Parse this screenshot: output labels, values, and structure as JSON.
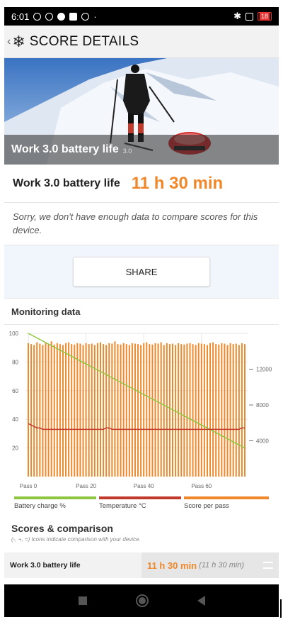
{
  "status_bar": {
    "time": "6:01",
    "battery": "18",
    "icons": [
      "alarm-off-icon",
      "alarm-icon",
      "apple-icon",
      "square-icon",
      "pie-icon",
      "dot-icon",
      "bluetooth-icon",
      "sim-icon",
      "battery-icon"
    ]
  },
  "header": {
    "back_icon": "chevron-left-icon",
    "logo_icon": "snowflake-icon",
    "title": "SCORE DETAILS"
  },
  "hero": {
    "title": "Work 3.0 battery life",
    "version": "3.0"
  },
  "score": {
    "label": "Work 3.0 battery life",
    "value": "11 h 30 min"
  },
  "message": "Sorry, we don't have enough data to compare scores for this device.",
  "share_label": "SHARE",
  "monitoring": {
    "title": "Monitoring data"
  },
  "chart_data": {
    "type": "line",
    "x_label_prefix": "Pass",
    "x_ticks": [
      "Pass 0",
      "Pass 20",
      "Pass 40",
      "Pass 60"
    ],
    "y_left_ticks": [
      "100",
      "80",
      "60",
      "40",
      "20"
    ],
    "y_right_ticks": [
      "12000",
      "8000",
      "4000"
    ],
    "pass_count": 76,
    "battery_charge_start": 100,
    "battery_charge_end": 20,
    "temperature_values": [
      37,
      36,
      35,
      34,
      34,
      33,
      33,
      33,
      33,
      33,
      33,
      33,
      33,
      33,
      33,
      33,
      33,
      33,
      33,
      33,
      33,
      33,
      33,
      33,
      33,
      33,
      33,
      34,
      34,
      33,
      33,
      33,
      33,
      33,
      33,
      33,
      33,
      33,
      33,
      33,
      33,
      33,
      33,
      33,
      33,
      33,
      33,
      33,
      33,
      33,
      33,
      33,
      33,
      33,
      33,
      33,
      33,
      33,
      33,
      33,
      33,
      33,
      33,
      33,
      33,
      33,
      33,
      33,
      33,
      33,
      33,
      33,
      33,
      33,
      34,
      34
    ],
    "score_values": [
      14900,
      14800,
      14700,
      15000,
      14850,
      14700,
      14900,
      14800,
      15100,
      14750,
      14900,
      14800,
      14700,
      14900,
      15000,
      14800,
      14750,
      14900,
      14850,
      14700,
      14900,
      14800,
      14850,
      14700,
      14900,
      15000,
      14800,
      14700,
      14900,
      14850,
      15100,
      14800,
      14750,
      14900,
      14800,
      14700,
      14900,
      14850,
      14800,
      14700,
      14900,
      15000,
      14800,
      14750,
      14900,
      14850,
      15000,
      14700,
      14900,
      14800,
      14850,
      14700,
      14900,
      14800,
      14750,
      14850,
      14900,
      14800,
      14700,
      14900,
      14850,
      14800,
      14700,
      14900,
      15000,
      14800,
      14750,
      14900,
      14850,
      14700,
      14900,
      14800,
      14850,
      14700,
      14900,
      14800
    ],
    "y_left_range": [
      0,
      100
    ],
    "y_right_range": [
      0,
      16000
    ],
    "colors": {
      "battery": "#8dc63f",
      "temperature": "#c0392b",
      "score": "#f0882a",
      "grid": "#e6e6e6"
    },
    "legend": [
      "Battery charge %",
      "Temperature °C",
      "Score per pass"
    ]
  },
  "scores": {
    "title": "Scores & comparison",
    "subtitle": "(-, +, =) Icons indicate comparison with your device."
  },
  "result": {
    "label": "Work 3.0 battery life",
    "value": "11 h 30 min",
    "paren": "(11 h 30 min)"
  },
  "colors": {
    "accent": "#f0882a",
    "share_band": "#f0f6fb"
  }
}
